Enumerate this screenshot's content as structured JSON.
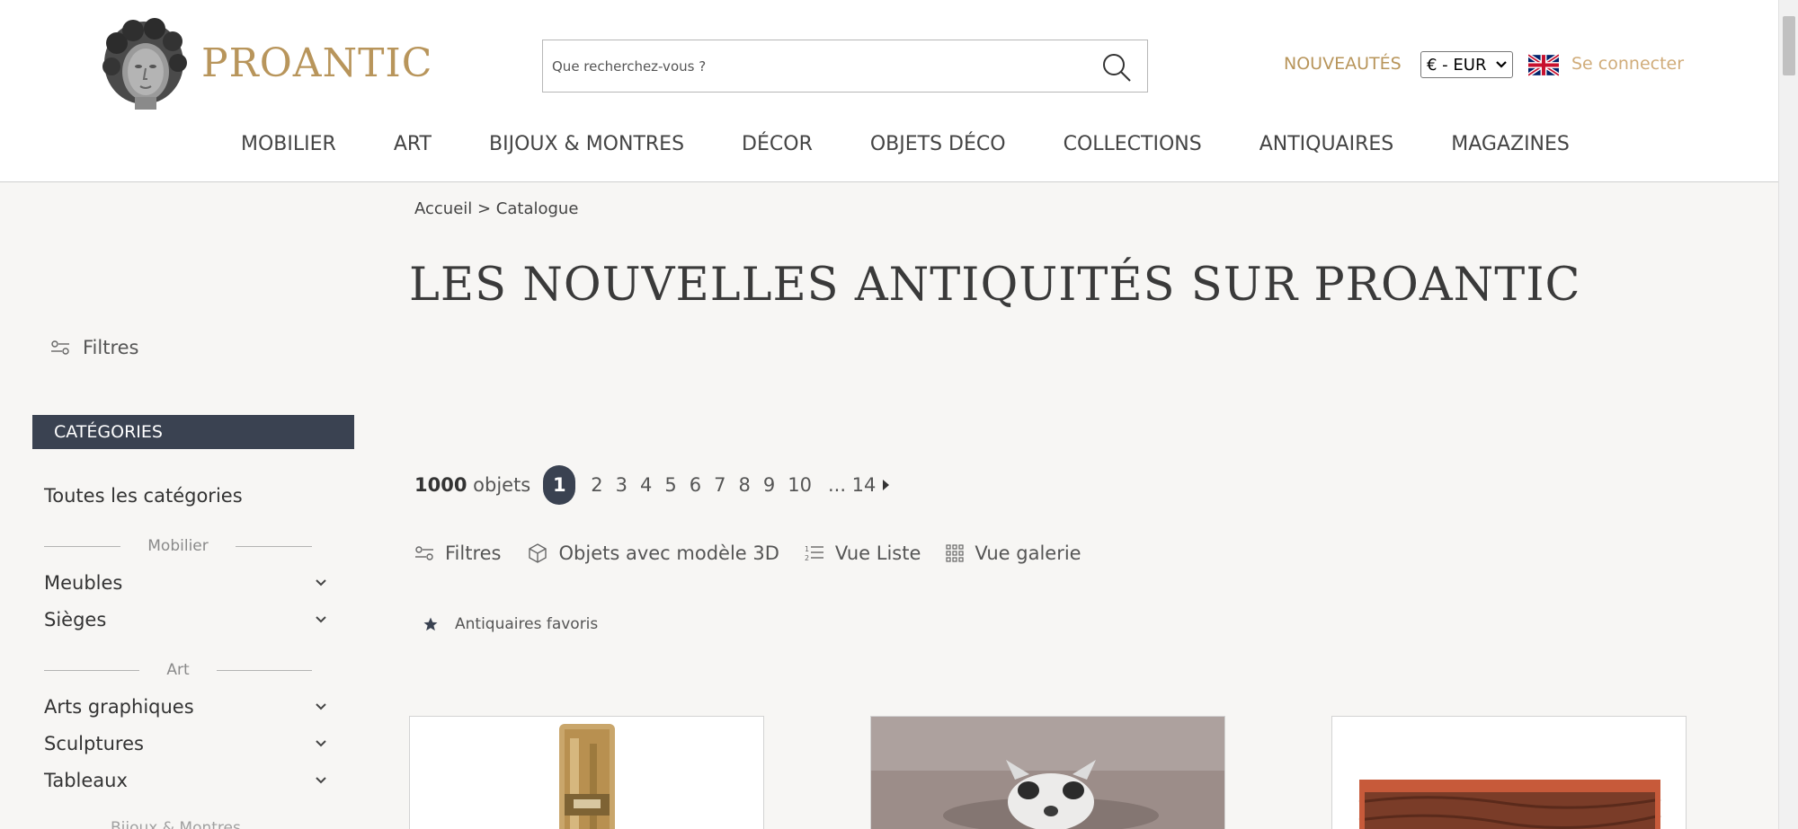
{
  "header": {
    "brand": "PROANTIC",
    "search_placeholder": "Que recherchez-vous ?",
    "new_label": "NOUVEAUTÉS",
    "currency": "€ - EUR",
    "login_label": "Se connecter"
  },
  "nav": [
    "MOBILIER",
    "ART",
    "BIJOUX & MONTRES",
    "DÉCOR",
    "OBJETS DÉCO",
    "COLLECTIONS",
    "ANTIQUAIRES",
    "MAGAZINES"
  ],
  "sidebar": {
    "filters_label": "Filtres",
    "categories_heading": "CATÉGORIES",
    "all_categories": "Toutes les catégories",
    "section_mobilier": "Mobilier",
    "items_mobilier": [
      "Meubles",
      "Sièges"
    ],
    "section_art": "Art",
    "items_art": [
      "Arts graphiques",
      "Sculptures",
      "Tableaux"
    ],
    "section_bijoux": "Bijoux & Montres"
  },
  "breadcrumb": "Accueil > Catalogue",
  "page_title": "LES NOUVELLES ANTIQUITÉS SUR PROANTIC",
  "pagination": {
    "count_number": "1000",
    "count_label": "objets",
    "current": "1",
    "pages": [
      "2",
      "3",
      "4",
      "5",
      "6",
      "7",
      "8",
      "9",
      "10"
    ],
    "last": "... 14"
  },
  "toolbar": {
    "filters": "Filtres",
    "models3d": "Objets avec modèle 3D",
    "list_view": "Vue Liste",
    "gallery_view": "Vue galerie"
  },
  "favorites_label": "Antiquaires favoris",
  "colors": {
    "gold": "#b8955b",
    "dark": "#3a4251",
    "background": "#f7f6f4"
  }
}
